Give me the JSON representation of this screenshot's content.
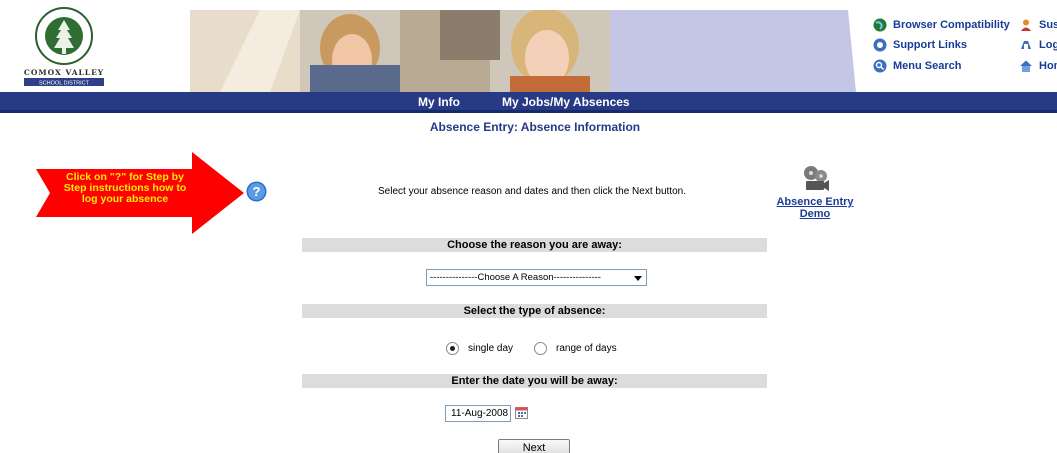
{
  "header": {
    "logo_text_top": "A COMMUNITY OF LEARNERS",
    "logo_text_bottom_1": "COMOX VALLEY",
    "logo_text_bottom_2": "SCHOOL DISTRICT",
    "links": {
      "browser_compat": "Browser Compatibility",
      "support_links": "Support Links",
      "menu_search": "Menu Search",
      "user": "Susa",
      "logout": "Logo",
      "home": "Hom"
    }
  },
  "nav": {
    "items": [
      "My Info",
      "My Jobs/My Absences"
    ]
  },
  "page": {
    "title": "Absence Entry: Absence Information",
    "callout": "Click on \"?\" for Step by Step instructions how to log your absence",
    "instructions": "Select your absence reason and dates and then click the Next button.",
    "demo_link": "Absence Entry Demo"
  },
  "form": {
    "reason_label": "Choose the reason you are away:",
    "reason_selected": "---------------Choose A Reason---------------",
    "type_label": "Select the type of absence:",
    "type_options": [
      "single day",
      "range of days"
    ],
    "type_selected": "single day",
    "date_label": "Enter the date you will be away:",
    "date_value": "11-Aug-2008",
    "next_label": "Next"
  },
  "colors": {
    "navbar": "#263a86",
    "link": "#1a3b96",
    "callout_arrow": "#ff0000",
    "callout_text": "#ffee00",
    "section_bg": "#dcdcdc"
  }
}
